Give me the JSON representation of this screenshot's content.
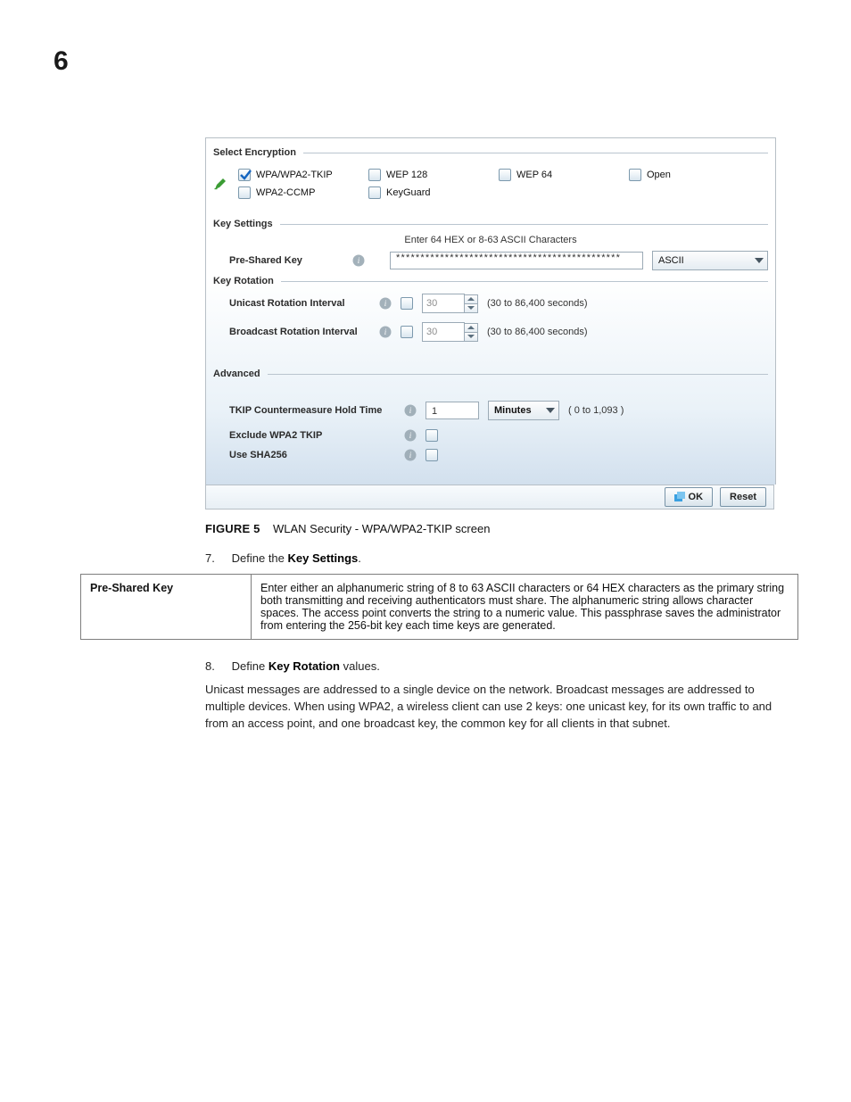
{
  "page_number": "6",
  "panel": {
    "sections": {
      "select_encryption": "Select Encryption",
      "key_settings": "Key Settings",
      "key_rotation": "Key Rotation",
      "advanced": "Advanced"
    },
    "encryption": {
      "wpa_tkip": "WPA/WPA2-TKIP",
      "wpa2_ccmp": "WPA2-CCMP",
      "wep128": "WEP 128",
      "keyguard": "KeyGuard",
      "wep64": "WEP 64",
      "open": "Open"
    },
    "key_settings": {
      "hint": "Enter 64 HEX or 8-63 ASCII Characters",
      "psk_label": "Pre-Shared Key",
      "psk_value": "**********************************************",
      "psk_format": "ASCII"
    },
    "key_rotation": {
      "unicast_label": "Unicast Rotation Interval",
      "unicast_value": "30",
      "broadcast_label": "Broadcast Rotation Interval",
      "broadcast_value": "30",
      "range": "(30 to 86,400 seconds)"
    },
    "advanced": {
      "tkip_label": "TKIP Countermeasure Hold Time",
      "tkip_value": "1",
      "tkip_unit": "Minutes",
      "tkip_range": "( 0 to 1,093 )",
      "exclude_label": "Exclude WPA2 TKIP",
      "sha256_label": "Use SHA256"
    },
    "buttons": {
      "ok": "OK",
      "reset": "Reset"
    }
  },
  "caption": {
    "prefix": "FIGURE 5",
    "text": "WLAN Security - WPA/WPA2-TKIP screen"
  },
  "steps": {
    "s7_num": "7.",
    "s7_a": "Define the ",
    "s7_b": "Key Settings",
    "s7_c": ".",
    "s8_num": "8.",
    "s8_a": "Define ",
    "s8_b": "Key Rotation",
    "s8_c": " values."
  },
  "definition": {
    "name": "Pre-Shared Key",
    "desc": "Enter either an alphanumeric string of 8 to 63 ASCII characters or 64 HEX characters as the primary string both transmitting and receiving authenticators must share. The alphanumeric string allows character spaces. The access point converts the string to a numeric value. This passphrase saves the administrator from entering the 256-bit key each time keys are generated."
  },
  "paragraph": "Unicast messages are addressed to a single device on the network. Broadcast messages are addressed to multiple devices. When using WPA2, a wireless client can use 2 keys: one unicast key, for its own traffic to and from an access point, and one broadcast key, the common key for all clients in that subnet."
}
